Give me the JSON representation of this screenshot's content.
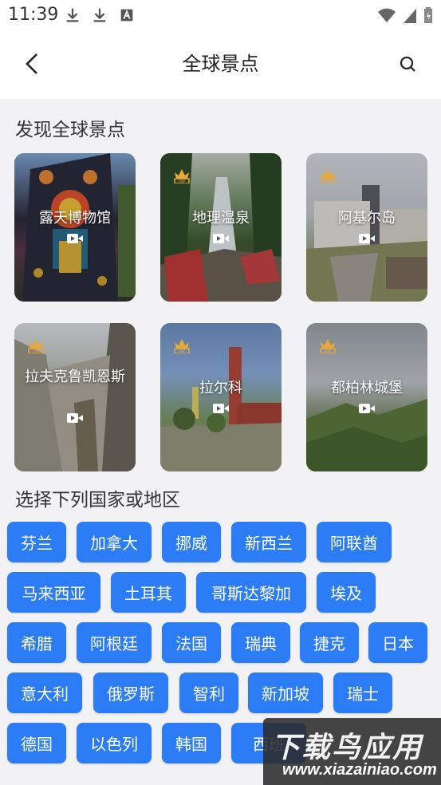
{
  "status": {
    "time": "11:39"
  },
  "header": {
    "title": "全球景点"
  },
  "sections": {
    "discover": "发现全球景点",
    "choose": "选择下列国家或地区"
  },
  "cards": [
    {
      "label": "露天博物馆",
      "vip": false
    },
    {
      "label": "地理温泉",
      "vip": true
    },
    {
      "label": "阿基尔岛",
      "vip": true
    },
    {
      "label": "拉夫克鲁凯恩斯",
      "vip": true
    },
    {
      "label": "拉尔科",
      "vip": true
    },
    {
      "label": "都柏林城堡",
      "vip": true
    }
  ],
  "countries": [
    [
      "芬兰",
      "加拿大",
      "挪威",
      "新西兰",
      "阿联酋"
    ],
    [
      "马来西亚",
      "土耳其",
      "哥斯达黎加",
      "埃及"
    ],
    [
      "希腊",
      "阿根廷",
      "法国",
      "瑞典",
      "捷克",
      "日本"
    ],
    [
      "意大利",
      "俄罗斯",
      "智利",
      "新加坡",
      "瑞士"
    ],
    [
      "德国",
      "以色列",
      "韩国",
      "西班"
    ]
  ],
  "watermark": {
    "title": "下载鸟应用",
    "url": "www.xiazainiao.com"
  },
  "colors": {
    "chip": "#2c7cf6",
    "vip": "#e8a93a"
  },
  "icons": [
    "back-arrow-icon",
    "search-icon",
    "download-icon",
    "video-icon",
    "vip-crown-icon",
    "wifi-icon",
    "signal-icon",
    "battery-icon"
  ]
}
